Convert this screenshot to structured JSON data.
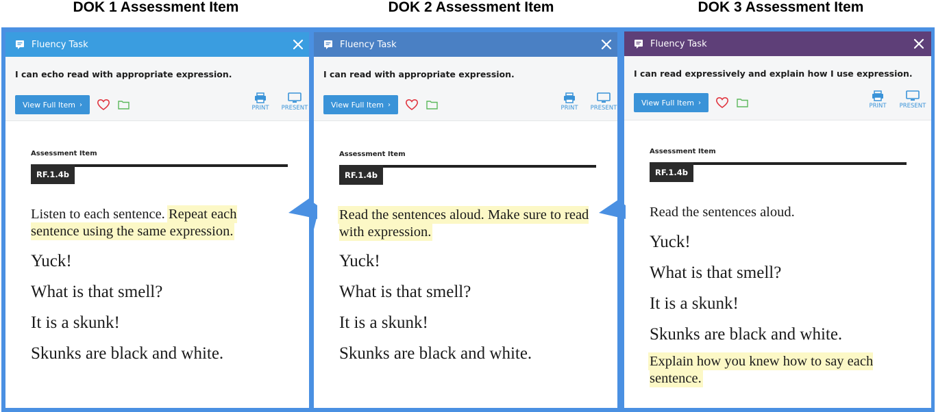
{
  "headings": [
    "DOK 1 Assessment Item",
    "DOK 2 Assessment Item",
    "DOK 3 Assessment Item"
  ],
  "colors": {
    "frame": "#4a90e2",
    "header_dok1": "#3a9de0",
    "header_dok2": "#4a80c4",
    "header_dok3": "#5e3f78",
    "button": "#3a93d8",
    "heart": "#e0343e",
    "folder": "#5cb85c",
    "highlight": "#fcf8c6"
  },
  "panels": [
    {
      "header_title": "Fluency Task",
      "objective": "I can echo read with appropriate expression.",
      "view_button": "View Full Item",
      "print_label": "PRINT",
      "present_label": "PRESENT",
      "assessment_label": "Assessment Item",
      "standard": "RF.1.4b",
      "prompt_plain": "Listen to each sentence. ",
      "prompt_highlight": "Repeat each sentence using the same expression.",
      "sentences": [
        "Yuck!",
        "What is that smell?",
        "It is a skunk!",
        "Skunks are black and white."
      ],
      "followup": ""
    },
    {
      "header_title": "Fluency Task",
      "objective": "I can read with appropriate expression.",
      "view_button": "View Full Item",
      "print_label": "PRINT",
      "present_label": "PRESENT",
      "assessment_label": "Assessment Item",
      "standard": "RF.1.4b",
      "prompt_plain": "",
      "prompt_highlight": "Read the sentences aloud. Make sure to read with expression.",
      "sentences": [
        "Yuck!",
        "What is that smell?",
        "It is a skunk!",
        "Skunks are black and white."
      ],
      "followup": ""
    },
    {
      "header_title": "Fluency Task",
      "objective": "I can read expressively and explain how I use expression.",
      "view_button": "View Full Item",
      "print_label": "PRINT",
      "present_label": "PRESENT",
      "assessment_label": "Assessment Item",
      "standard": "RF.1.4b",
      "prompt_plain": "Read the sentences aloud.",
      "prompt_highlight": "",
      "sentences": [
        "Yuck!",
        "What is that smell?",
        "It is a skunk!",
        "Skunks are black and white."
      ],
      "followup": "Explain how you knew how to say each sentence."
    }
  ]
}
